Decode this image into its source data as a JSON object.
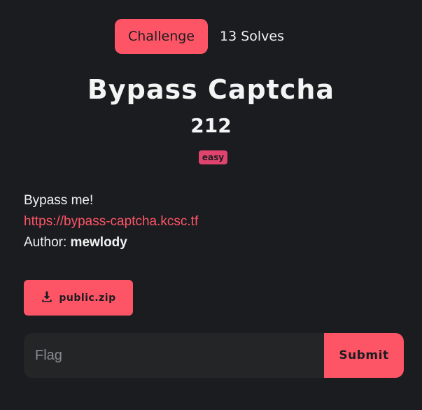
{
  "tabs": {
    "challenge_label": "Challenge",
    "solves_label": "13 Solves"
  },
  "challenge": {
    "title": "Bypass Captcha",
    "points": "212",
    "difficulty": "easy",
    "description_line": "Bypass me!",
    "link": "https://bypass-captcha.kcsc.tf",
    "author_prefix": "Author:",
    "author_name": "mewlody"
  },
  "download": {
    "label": "public.zip",
    "icon": "download-icon"
  },
  "flag_form": {
    "placeholder": "Flag",
    "submit_label": "Submit"
  },
  "colors": {
    "accent": "#fe5566",
    "background": "#1b1c20",
    "badge": "#e0446e"
  }
}
